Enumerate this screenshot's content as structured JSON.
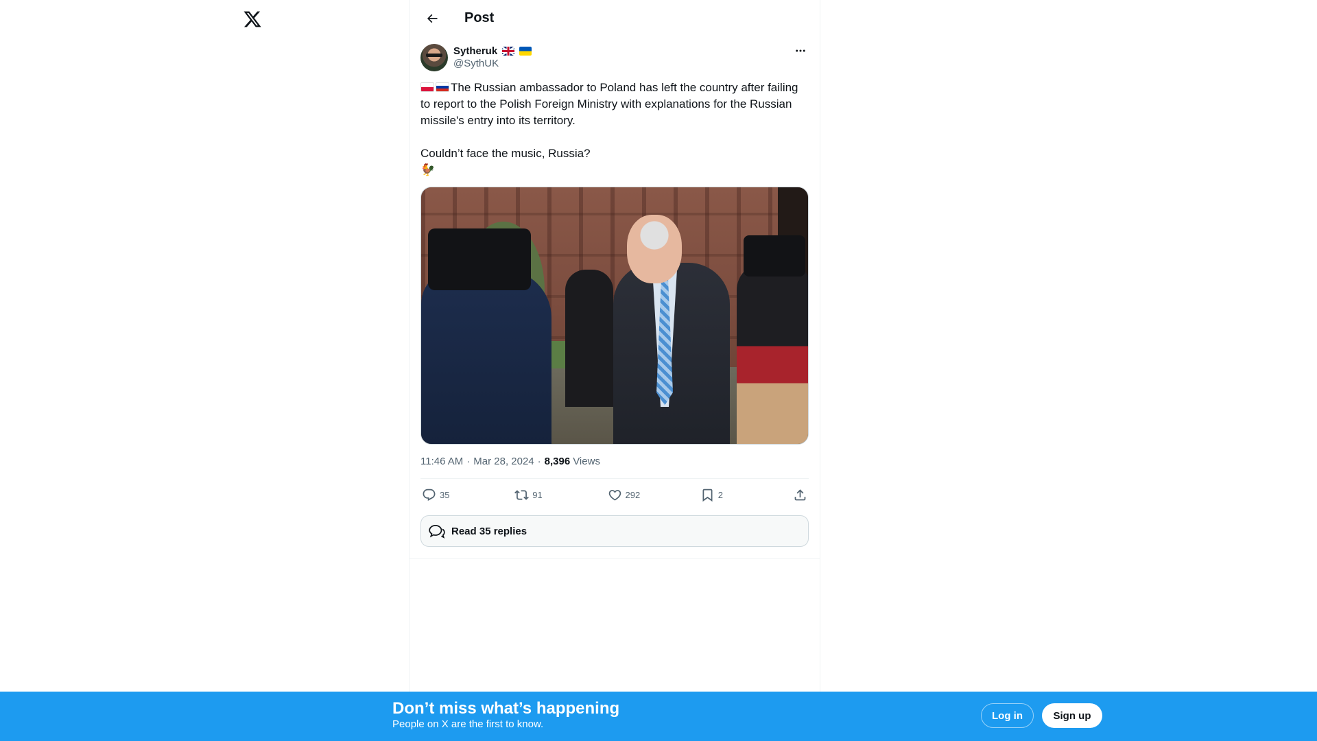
{
  "header": {
    "title": "Post"
  },
  "post": {
    "author": {
      "display_name": "Sytheruk",
      "flags": [
        "uk-flag",
        "ukraine-flag"
      ],
      "handle": "@SythUK"
    },
    "text_flags": [
      "poland-flag",
      "russia-flag"
    ],
    "text_line1": "The Russian ambassador to Poland has left the country after failing to report to the Polish Foreign Ministry with explanations for the Russian missile's entry into its territory.",
    "text_line2": "Couldn’t face the music, Russia?",
    "text_emoji": "🐓",
    "media": {
      "icon": "photo"
    },
    "time": "11:46 AM",
    "date": "Mar 28, 2024",
    "views_count": "8,396",
    "views_label": "Views",
    "stats": {
      "replies": "35",
      "reposts": "91",
      "likes": "292",
      "bookmarks": "2"
    },
    "read_replies": "Read 35 replies"
  },
  "banner": {
    "title": "Don’t miss what’s happening",
    "subtitle": "People on X are the first to know.",
    "login": "Log in",
    "signup": "Sign up"
  },
  "colors": {
    "accent": "#1d9bf0",
    "text": "#0f1419",
    "secondary": "#536471"
  }
}
